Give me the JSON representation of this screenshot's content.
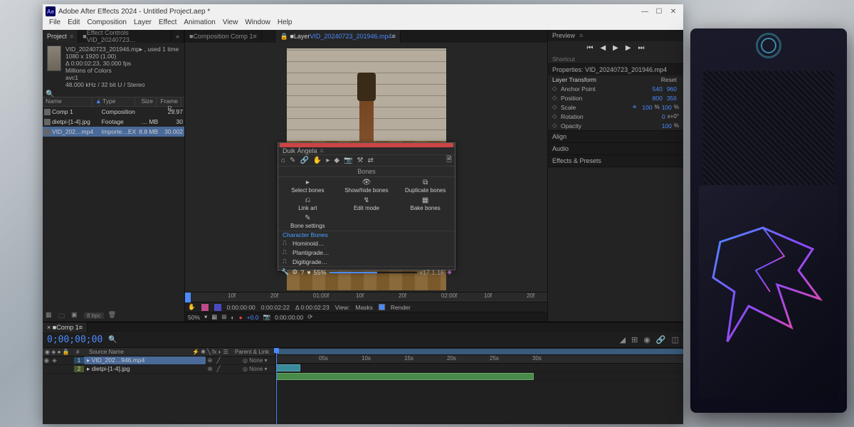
{
  "window": {
    "app_icon": "Ae",
    "title": "Adobe After Effects 2024 - Untitled Project.aep *"
  },
  "menu": [
    "File",
    "Edit",
    "Composition",
    "Layer",
    "Effect",
    "Animation",
    "View",
    "Window",
    "Help"
  ],
  "project": {
    "tab_project": "Project",
    "tab_effects": "Effect Controls  VID_20240723…",
    "clip_name": "VID_20240723_201946.mp▸ , used 1 time",
    "dims": "1080 x 1920 (1.00)",
    "duration": "Δ 0:00:02:23, 30.000 fps",
    "colors": "Millions of Colors",
    "codec": "avc1",
    "audio": "48.000 kHz / 32 bit U / Stereo",
    "cols": {
      "name": "Name",
      "type": "Type",
      "size": "Size",
      "fps": "Frame R…"
    },
    "items": [
      {
        "name": "Comp 1",
        "type": "Composition",
        "size": "",
        "fps": "29.97"
      },
      {
        "name": "dietpi-[1-4].jpg",
        "type": "Footage",
        "size": "… MB",
        "fps": "30"
      },
      {
        "name": "VID_202…mp4",
        "type": "Importe…EX",
        "size": "8.8 MB",
        "fps": "30.002"
      }
    ],
    "footer_bpc": "8 bpc"
  },
  "center": {
    "tab_comp": "Composition   Comp 1",
    "tab_layer_prefix": "Layer",
    "tab_layer_name": "VID_20240723_201946.mp4",
    "ruler_ticks": [
      "10f",
      "20f",
      "01:00f",
      "10f",
      "20f",
      "02:00f",
      "10f",
      "20f"
    ],
    "layer_row": {
      "in": "0:00:00:00",
      "out": "0:00:02:22",
      "dur": "Δ 0:00:02:23",
      "view": "View:",
      "masks": "Masks",
      "render": "Render"
    },
    "zoom": "50%",
    "zoom_delta": "+0.0",
    "zoom_time": "0:00:00:00"
  },
  "duik": {
    "name": "Duik Ángela",
    "section": "Bones",
    "cells": [
      {
        "i": "▸",
        "l": "Select bones"
      },
      {
        "i": "👁",
        "l": "Show/hide bones"
      },
      {
        "i": "⧉",
        "l": "Duplicate bones"
      },
      {
        "i": "⎌",
        "l": "Link art"
      },
      {
        "i": "↯",
        "l": "Edit mode"
      },
      {
        "i": "▦",
        "l": "Bake bones"
      },
      {
        "i": "✎",
        "l": "Bone settings"
      }
    ],
    "char_header": "Character Bones",
    "chars": [
      "Hominoid…",
      "Plantigrade…",
      "Digitigrade…"
    ],
    "progress": "55%",
    "version": "v17.1.16"
  },
  "right": {
    "preview": "Preview",
    "shortcut": "Shortcut",
    "properties": "Properties: VID_20240723_201946.mp4",
    "transform_hdr": "Layer Transform",
    "reset": "Reset",
    "props": {
      "anchor": {
        "n": "Anchor Point",
        "v1": "540",
        "v2": "960"
      },
      "position": {
        "n": "Position",
        "v1": "800",
        "v2": "356"
      },
      "scale": {
        "n": "Scale",
        "v1": "100",
        "u1": "%",
        "v2": "100",
        "u2": "%"
      },
      "rotation": {
        "n": "Rotation",
        "v1": "0",
        "u1": "x+0°"
      },
      "opacity": {
        "n": "Opacity",
        "v1": "100",
        "u1": "%"
      }
    },
    "align": "Align",
    "audio": "Audio",
    "effects": "Effects & Presets"
  },
  "timeline": {
    "tab": "Comp 1",
    "timecode": "0;00;00;00",
    "cols": {
      "src": "Source Name",
      "parent": "Parent & Link"
    },
    "none": "None",
    "rows": [
      {
        "num": "1",
        "name": "VID_202…946.mp4",
        "hl": true
      },
      {
        "num": "2",
        "name": "dietpi-[1-4].jpg",
        "hl": false
      }
    ],
    "ticks": [
      "05s",
      "10s",
      "15s",
      "20s",
      "25s",
      "30s"
    ]
  }
}
